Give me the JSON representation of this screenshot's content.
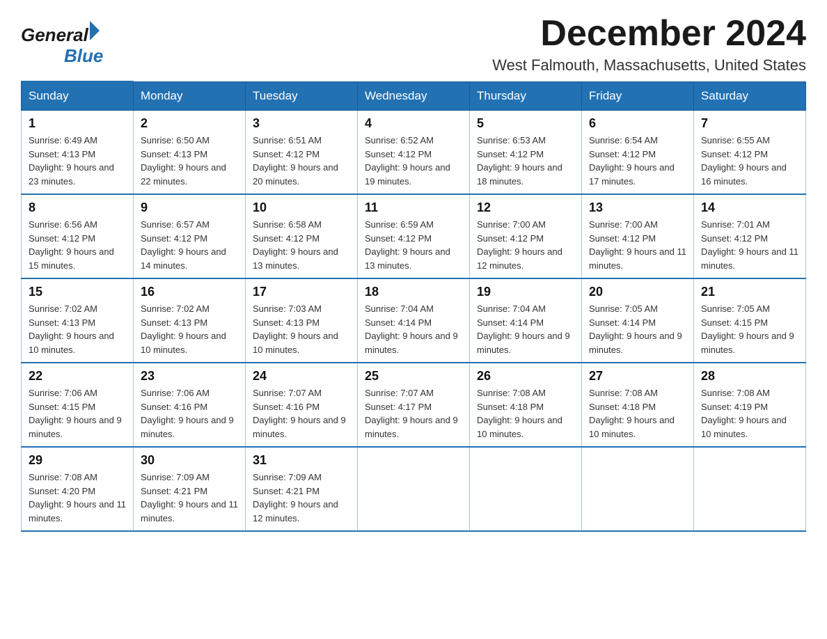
{
  "logo": {
    "general": "General",
    "blue": "Blue"
  },
  "title": "December 2024",
  "location": "West Falmouth, Massachusetts, United States",
  "days_of_week": [
    "Sunday",
    "Monday",
    "Tuesday",
    "Wednesday",
    "Thursday",
    "Friday",
    "Saturday"
  ],
  "weeks": [
    [
      {
        "day": 1,
        "sunrise": "6:49 AM",
        "sunset": "4:13 PM",
        "daylight": "9 hours and 23 minutes."
      },
      {
        "day": 2,
        "sunrise": "6:50 AM",
        "sunset": "4:13 PM",
        "daylight": "9 hours and 22 minutes."
      },
      {
        "day": 3,
        "sunrise": "6:51 AM",
        "sunset": "4:12 PM",
        "daylight": "9 hours and 20 minutes."
      },
      {
        "day": 4,
        "sunrise": "6:52 AM",
        "sunset": "4:12 PM",
        "daylight": "9 hours and 19 minutes."
      },
      {
        "day": 5,
        "sunrise": "6:53 AM",
        "sunset": "4:12 PM",
        "daylight": "9 hours and 18 minutes."
      },
      {
        "day": 6,
        "sunrise": "6:54 AM",
        "sunset": "4:12 PM",
        "daylight": "9 hours and 17 minutes."
      },
      {
        "day": 7,
        "sunrise": "6:55 AM",
        "sunset": "4:12 PM",
        "daylight": "9 hours and 16 minutes."
      }
    ],
    [
      {
        "day": 8,
        "sunrise": "6:56 AM",
        "sunset": "4:12 PM",
        "daylight": "9 hours and 15 minutes."
      },
      {
        "day": 9,
        "sunrise": "6:57 AM",
        "sunset": "4:12 PM",
        "daylight": "9 hours and 14 minutes."
      },
      {
        "day": 10,
        "sunrise": "6:58 AM",
        "sunset": "4:12 PM",
        "daylight": "9 hours and 13 minutes."
      },
      {
        "day": 11,
        "sunrise": "6:59 AM",
        "sunset": "4:12 PM",
        "daylight": "9 hours and 13 minutes."
      },
      {
        "day": 12,
        "sunrise": "7:00 AM",
        "sunset": "4:12 PM",
        "daylight": "9 hours and 12 minutes."
      },
      {
        "day": 13,
        "sunrise": "7:00 AM",
        "sunset": "4:12 PM",
        "daylight": "9 hours and 11 minutes."
      },
      {
        "day": 14,
        "sunrise": "7:01 AM",
        "sunset": "4:12 PM",
        "daylight": "9 hours and 11 minutes."
      }
    ],
    [
      {
        "day": 15,
        "sunrise": "7:02 AM",
        "sunset": "4:13 PM",
        "daylight": "9 hours and 10 minutes."
      },
      {
        "day": 16,
        "sunrise": "7:02 AM",
        "sunset": "4:13 PM",
        "daylight": "9 hours and 10 minutes."
      },
      {
        "day": 17,
        "sunrise": "7:03 AM",
        "sunset": "4:13 PM",
        "daylight": "9 hours and 10 minutes."
      },
      {
        "day": 18,
        "sunrise": "7:04 AM",
        "sunset": "4:14 PM",
        "daylight": "9 hours and 9 minutes."
      },
      {
        "day": 19,
        "sunrise": "7:04 AM",
        "sunset": "4:14 PM",
        "daylight": "9 hours and 9 minutes."
      },
      {
        "day": 20,
        "sunrise": "7:05 AM",
        "sunset": "4:14 PM",
        "daylight": "9 hours and 9 minutes."
      },
      {
        "day": 21,
        "sunrise": "7:05 AM",
        "sunset": "4:15 PM",
        "daylight": "9 hours and 9 minutes."
      }
    ],
    [
      {
        "day": 22,
        "sunrise": "7:06 AM",
        "sunset": "4:15 PM",
        "daylight": "9 hours and 9 minutes."
      },
      {
        "day": 23,
        "sunrise": "7:06 AM",
        "sunset": "4:16 PM",
        "daylight": "9 hours and 9 minutes."
      },
      {
        "day": 24,
        "sunrise": "7:07 AM",
        "sunset": "4:16 PM",
        "daylight": "9 hours and 9 minutes."
      },
      {
        "day": 25,
        "sunrise": "7:07 AM",
        "sunset": "4:17 PM",
        "daylight": "9 hours and 9 minutes."
      },
      {
        "day": 26,
        "sunrise": "7:08 AM",
        "sunset": "4:18 PM",
        "daylight": "9 hours and 10 minutes."
      },
      {
        "day": 27,
        "sunrise": "7:08 AM",
        "sunset": "4:18 PM",
        "daylight": "9 hours and 10 minutes."
      },
      {
        "day": 28,
        "sunrise": "7:08 AM",
        "sunset": "4:19 PM",
        "daylight": "9 hours and 10 minutes."
      }
    ],
    [
      {
        "day": 29,
        "sunrise": "7:08 AM",
        "sunset": "4:20 PM",
        "daylight": "9 hours and 11 minutes."
      },
      {
        "day": 30,
        "sunrise": "7:09 AM",
        "sunset": "4:21 PM",
        "daylight": "9 hours and 11 minutes."
      },
      {
        "day": 31,
        "sunrise": "7:09 AM",
        "sunset": "4:21 PM",
        "daylight": "9 hours and 12 minutes."
      },
      null,
      null,
      null,
      null
    ]
  ]
}
